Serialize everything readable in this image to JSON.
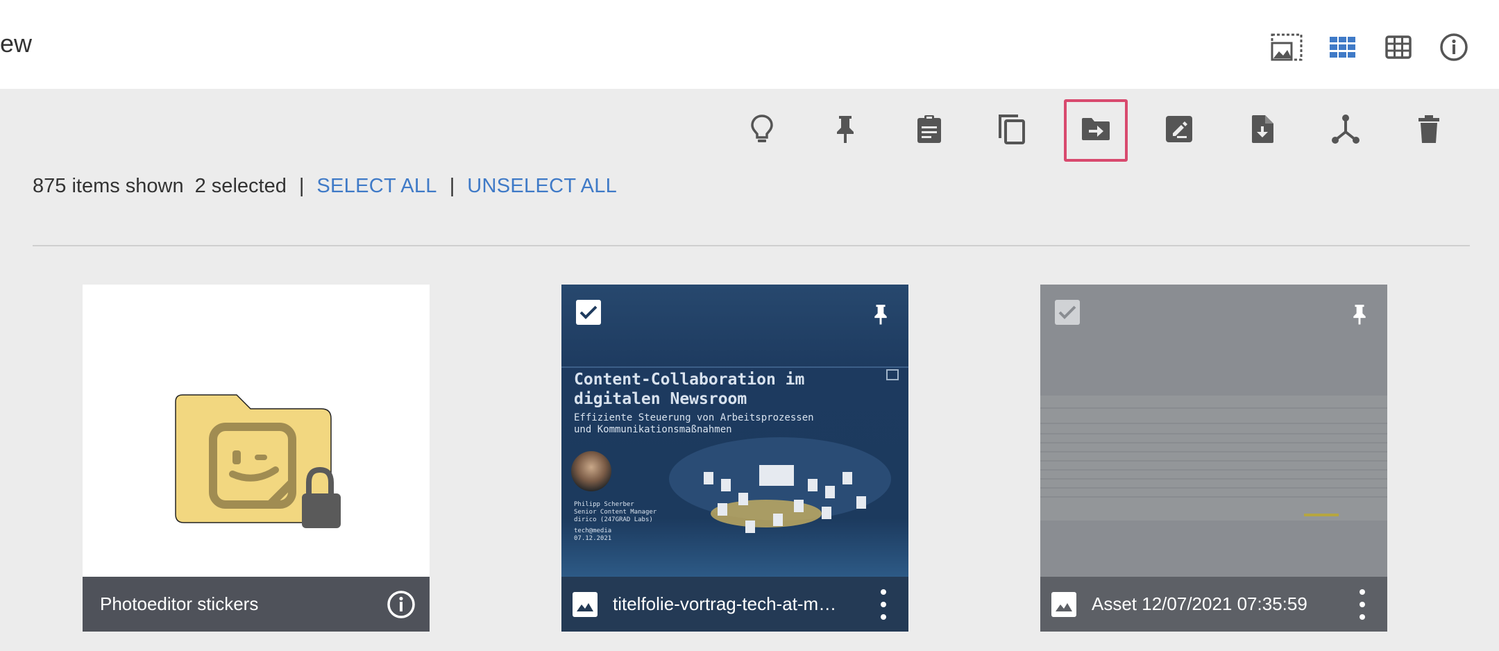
{
  "header": {
    "title": "ew",
    "icons": [
      "image-area-icon",
      "grid-view-icon",
      "table-view-icon",
      "info-icon"
    ]
  },
  "toolbar": {
    "buttons": [
      {
        "icon": "lightbulb-icon"
      },
      {
        "icon": "pin-icon"
      },
      {
        "icon": "clipboard-icon"
      },
      {
        "icon": "copy-icon"
      },
      {
        "icon": "move-to-folder-icon",
        "active": true
      },
      {
        "icon": "edit-icon"
      },
      {
        "icon": "download-file-icon"
      },
      {
        "icon": "merge-icon"
      },
      {
        "icon": "delete-icon"
      }
    ]
  },
  "status": {
    "items_shown": "875 items shown",
    "selected": "2 selected",
    "separator": "|",
    "select_all": "SELECT ALL",
    "unselect_all": "UNSELECT ALL"
  },
  "cards": [
    {
      "label": "Photoeditor stickers",
      "type": "folder",
      "selected": false
    },
    {
      "label": "titelfolie-vortrag-tech-at-me…",
      "type": "image",
      "selected": true,
      "pinned": true,
      "slide": {
        "title_line1": "Content-Collaboration im",
        "title_line2": "digitalen Newsroom",
        "subtitle_line1": "Effiziente Steuerung von Arbeitsprozessen",
        "subtitle_line2": "und Kommunikationsmaßnahmen",
        "speaker_line1": "Philipp Scherber",
        "speaker_line2": "Senior Content Manager",
        "speaker_line3": "dirico (247GRAD Labs)",
        "event_line1": "tech@media",
        "event_line2": "07.12.2021"
      }
    },
    {
      "label": "Asset 12/07/2021 07:35:59",
      "type": "image",
      "selected": true,
      "pinned": true
    }
  ],
  "colors": {
    "accent_link": "#3f7ac7",
    "active_outline": "#d84a6e",
    "footer_bg": "#4f525a",
    "folder_yellow": "#f2d780"
  }
}
